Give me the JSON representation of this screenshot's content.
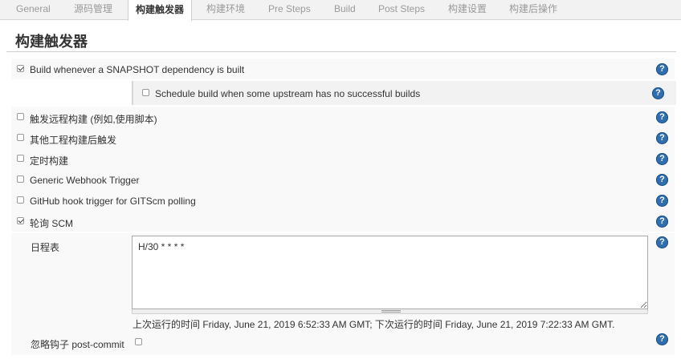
{
  "tabs": [
    {
      "label": "General",
      "active": false
    },
    {
      "label": "源码管理",
      "active": false
    },
    {
      "label": "构建触发器",
      "active": true
    },
    {
      "label": "构建环境",
      "active": false
    },
    {
      "label": "Pre Steps",
      "active": false
    },
    {
      "label": "Build",
      "active": false
    },
    {
      "label": "Post Steps",
      "active": false
    },
    {
      "label": "构建设置",
      "active": false
    },
    {
      "label": "构建后操作",
      "active": false
    }
  ],
  "section_title": "构建触发器",
  "triggers": [
    {
      "label": "Build whenever a SNAPSHOT dependency is built",
      "checked": true
    },
    {
      "label": "Schedule build when some upstream has no successful builds",
      "checked": false
    },
    {
      "label": "触发远程构建 (例如,使用脚本)",
      "checked": false
    },
    {
      "label": "其他工程构建后触发",
      "checked": false
    },
    {
      "label": "定时构建",
      "checked": false
    },
    {
      "label": "Generic Webhook Trigger",
      "checked": false
    },
    {
      "label": "GitHub hook trigger for GITScm polling",
      "checked": false
    },
    {
      "label": "轮询 SCM",
      "checked": true
    }
  ],
  "schedule": {
    "label": "日程表",
    "value": "H/30 * * * *",
    "run_info": "上次运行的时间 Friday, June 21, 2019 6:52:33 AM GMT; 下次运行的时间 Friday, June 21, 2019 7:22:33 AM GMT."
  },
  "ignore_post_commit": {
    "label": "忽略钩子 post-commit",
    "checked": false
  },
  "help_icon_glyph": "?"
}
